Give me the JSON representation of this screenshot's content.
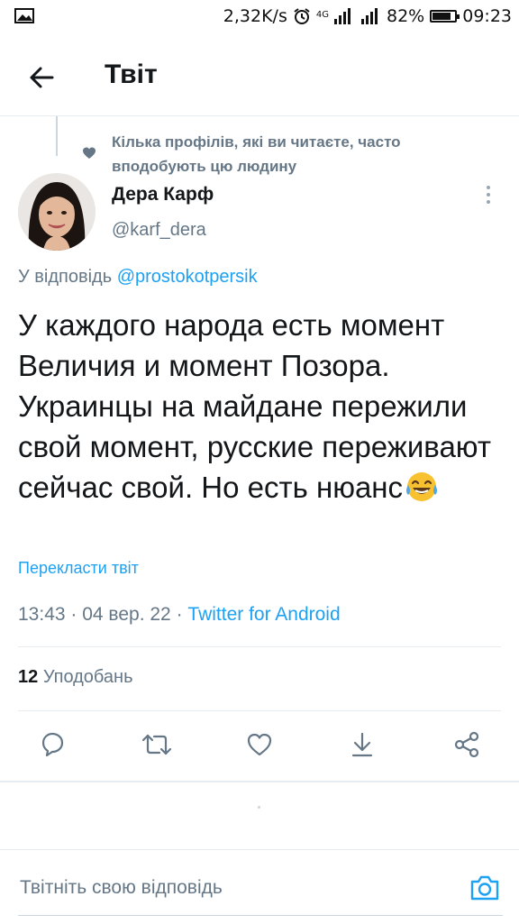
{
  "status_bar": {
    "speed": "2,32K/s",
    "network": "4G",
    "battery": "82%",
    "battery_level": 0.82,
    "time": "09:23"
  },
  "header": {
    "title": "Твіт"
  },
  "social_context": "Кілька профілів, які ви читаєте, часто вподобують цю людину",
  "author": {
    "name": "Дера Карф",
    "handle": "@karf_dera"
  },
  "reply_to": {
    "prefix": "У відповідь",
    "mention": "@prostokotpersik"
  },
  "tweet": {
    "text": "У каждого народа есть момент Величия и момент Позора. Украинцы на майдане пережили свой момент, русские переживают сейчас свой. Но есть нюанс",
    "emoji": "face-with-tears-of-joy"
  },
  "translate_label": "Перекласти твіт",
  "meta": {
    "time": "13:43",
    "sep1": " · ",
    "date": "04 вер. 22",
    "sep2": " · ",
    "source": "Twitter for Android"
  },
  "stats": {
    "likes_count": "12",
    "likes_label": "Уподобань"
  },
  "actions": [
    "reply-icon",
    "retweet-icon",
    "like-icon",
    "share-download-icon",
    "share-icon"
  ],
  "reply_composer": {
    "placeholder": "Твітніть свою відповідь"
  },
  "colors": {
    "accent": "#1da1f2",
    "muted": "#657786",
    "text": "#14171a",
    "divider": "#e6ecf0"
  }
}
